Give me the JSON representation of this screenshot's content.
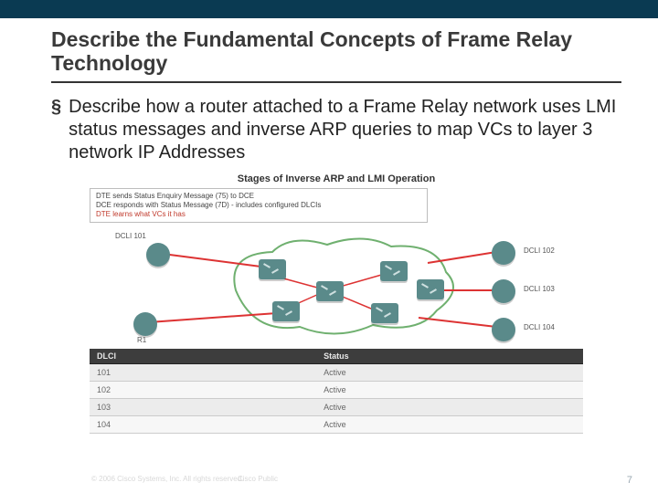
{
  "slide": {
    "title": "Describe the Fundamental Concepts of Frame Relay Technology",
    "bullet": "Describe how a router attached to a Frame Relay network uses LMI status messages and inverse ARP queries to map VCs to layer 3 network IP Addresses"
  },
  "figure": {
    "title": "Stages of Inverse ARP and LMI Operation",
    "box": {
      "line1": "DTE sends Status Enquiry Message (75) to DCE",
      "line2": "DCE responds with Status Message (7D) - includes configured DLCIs",
      "line3": "DTE learns what VCs it has"
    },
    "labels": {
      "left_top": "DCLI 101",
      "r1": "R1",
      "right1": "DCLI 102",
      "right2": "DCLI 103",
      "right3": "DCLI 104"
    }
  },
  "table": {
    "headers": [
      "DLCI",
      "Status"
    ],
    "rows": [
      [
        "101",
        "Active"
      ],
      [
        "102",
        "Active"
      ],
      [
        "103",
        "Active"
      ],
      [
        "104",
        "Active"
      ]
    ]
  },
  "footer": {
    "copyright": "© 2006 Cisco Systems, Inc. All rights reserved.",
    "classification": "Cisco Public",
    "page": "7"
  }
}
